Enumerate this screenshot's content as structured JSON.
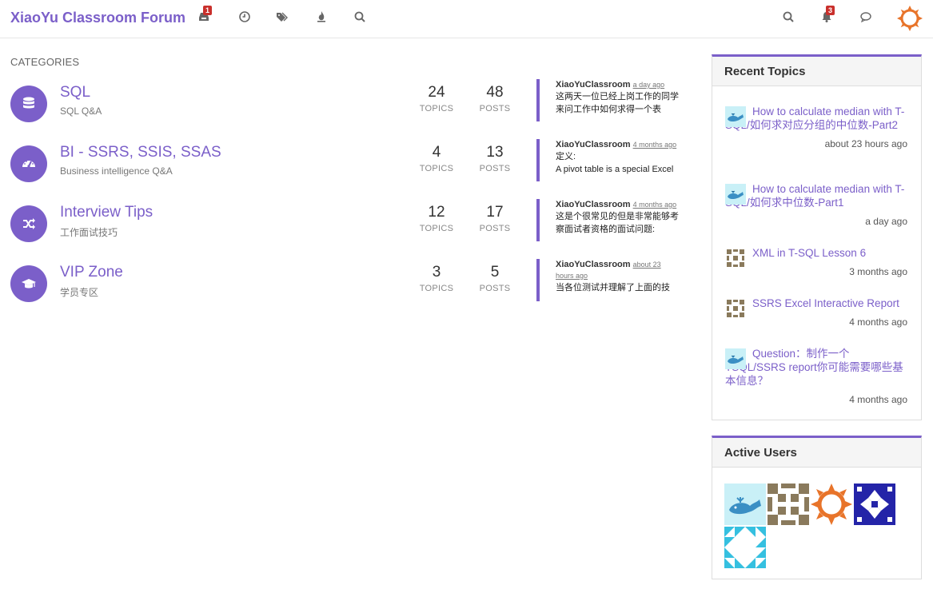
{
  "header": {
    "brand": "XiaoYu Classroom Forum",
    "nav_icons": [
      "inbox-icon",
      "clock-icon",
      "tags-icon",
      "fire-icon",
      "search-icon"
    ],
    "unread_badge": "1",
    "notification_badge": "3",
    "right_icons": [
      "search-icon",
      "bell-icon",
      "chat-icon",
      "user-avatar"
    ]
  },
  "categories": {
    "heading": "Categories",
    "topics_label": "TOPICS",
    "posts_label": "POSTS",
    "items": [
      {
        "title": "SQL",
        "description": "SQL Q&A",
        "icon": "database-icon",
        "topics": "24",
        "posts": "48",
        "teaser_user": "XiaoYuClassroom",
        "teaser_time": "a day ago",
        "teaser_text": "这两天一位已经上岗工作的同学来问工作中如何求得一个表"
      },
      {
        "title": "BI - SSRS, SSIS, SSAS",
        "description": "Business intelligence Q&A",
        "icon": "dashboard-icon",
        "topics": "4",
        "posts": "13",
        "teaser_user": "XiaoYuClassroom",
        "teaser_time": "4 months ago",
        "teaser_text": "定义:\nA pivot table is a special Excel"
      },
      {
        "title": "Interview Tips",
        "description": "工作面试技巧",
        "icon": "shuffle-icon",
        "topics": "12",
        "posts": "17",
        "teaser_user": "XiaoYuClassroom",
        "teaser_time": "4 months ago",
        "teaser_text": "这是个很常见的但是非常能够考察面试者资格的面试问题:"
      },
      {
        "title": "VIP Zone",
        "description": "学员专区",
        "icon": "graduation-cap-icon",
        "topics": "3",
        "posts": "5",
        "teaser_user": "XiaoYuClassroom",
        "teaser_time": "about 23 hours ago",
        "teaser_text": "当各位测试并理解了上面的技"
      }
    ]
  },
  "recent_topics": {
    "title": "Recent Topics",
    "items": [
      {
        "title": "How to calculate median with T-SQL/如何求对应分组的中位数-Part2",
        "ago": "about 23 hours ago",
        "avatar": "whale"
      },
      {
        "title": "How to calculate median with T-SQL/如何求中位数-Part1",
        "ago": "a day ago",
        "avatar": "whale"
      },
      {
        "title": "XML in T-SQL Lesson 6",
        "ago": "3 months ago",
        "avatar": "pattern-brown"
      },
      {
        "title": "SSRS Excel Interactive Report",
        "ago": "4 months ago",
        "avatar": "pattern-brown"
      },
      {
        "title": "Question：制作一个TSQL/SSRS report你可能需要哪些基本信息？",
        "ago": "4 months ago",
        "avatar": "whale"
      }
    ]
  },
  "active_users": {
    "title": "Active Users",
    "avatars": [
      "whale",
      "pattern-brown",
      "sun-orange",
      "pattern-blue",
      "pattern-cyan"
    ]
  },
  "colors": {
    "accent": "#7b5fc9",
    "badge": "#c9302c",
    "sun": "#e8742a"
  }
}
